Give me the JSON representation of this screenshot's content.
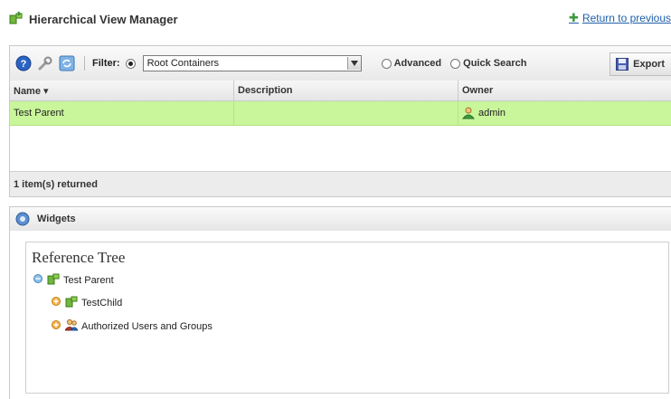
{
  "header": {
    "title": "Hierarchical View Manager",
    "return_link": "Return to previous"
  },
  "toolbar": {
    "filter_label": "Filter:",
    "filter_select_value": "Root Containers",
    "radio_advanced": "Advanced",
    "radio_quick_search": "Quick Search",
    "export_label": "Export"
  },
  "grid": {
    "columns": [
      "Name ▾",
      "Description",
      "Owner"
    ],
    "rows": [
      {
        "name": "Test Parent",
        "description": "",
        "owner": "admin"
      }
    ],
    "footer": "1 item(s) returned"
  },
  "widgets": {
    "title": "Widgets",
    "tree_title": "Reference Tree",
    "nodes": [
      {
        "label": "Test Parent"
      },
      {
        "label": "TestChild"
      },
      {
        "label": "Authorized Users and Groups"
      }
    ]
  },
  "colors": {
    "selected_row": "#c9f59b",
    "link": "#1f5fa8"
  }
}
